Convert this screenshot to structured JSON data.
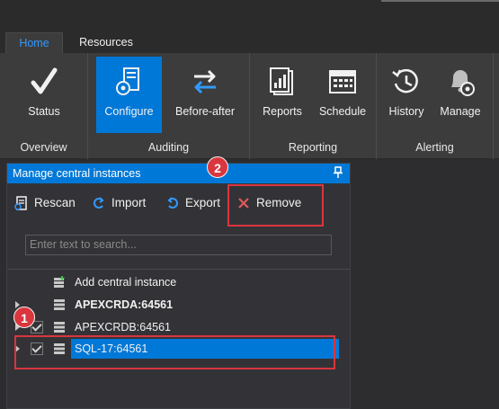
{
  "tabs": [
    {
      "label": "Home",
      "active": true
    },
    {
      "label": "Resources",
      "active": false
    }
  ],
  "ribbon": {
    "groups": [
      {
        "label": "Overview",
        "buttons": [
          {
            "label": "Status",
            "icon": "checkmark-icon"
          }
        ]
      },
      {
        "label": "Auditing",
        "buttons": [
          {
            "label": "Configure",
            "icon": "configure-server-icon",
            "selected": true
          },
          {
            "label": "Before-after",
            "icon": "swap-arrows-icon"
          }
        ]
      },
      {
        "label": "Reporting",
        "buttons": [
          {
            "label": "Reports",
            "icon": "reports-icon"
          },
          {
            "label": "Schedule",
            "icon": "calendar-icon"
          }
        ]
      },
      {
        "label": "Alerting",
        "buttons": [
          {
            "label": "History",
            "icon": "history-icon"
          },
          {
            "label": "Manage",
            "icon": "bell-gear-icon"
          }
        ]
      }
    ]
  },
  "panel": {
    "title": "Manage central instances",
    "toolbar": {
      "rescan": "Rescan",
      "import": "Import",
      "export": "Export",
      "remove": "Remove"
    },
    "search_placeholder": "Enter text to search...",
    "tree": [
      {
        "label": "Add central instance",
        "expandable": false,
        "checkbox": false,
        "bold": false,
        "selected": false
      },
      {
        "label": "APEXCRDA:64561",
        "expandable": true,
        "checkbox": false,
        "bold": true,
        "selected": false
      },
      {
        "label": "APEXCRDB:64561",
        "expandable": true,
        "checkbox": true,
        "checked": true,
        "bold": false,
        "selected": false
      },
      {
        "label": "SQL-17:64561",
        "expandable": true,
        "checkbox": true,
        "checked": true,
        "bold": false,
        "selected": true
      }
    ]
  },
  "annotations": {
    "badge_1": "1",
    "badge_2": "2"
  },
  "colors": {
    "accent": "#0078d7",
    "callout": "#d9363e",
    "background": "#2d2d30"
  }
}
